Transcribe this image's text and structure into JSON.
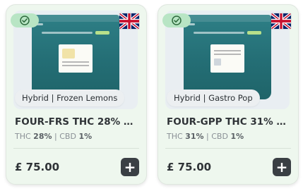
{
  "colors": {
    "card_bg": "#eef7ee",
    "verified_badge": "#b8e5c4",
    "add_button": "#3a3f44",
    "bag_teal": "#2e7f86"
  },
  "products": [
    {
      "verified_icon": "check-circle-icon",
      "flag_icon": "uk-flag-icon",
      "strain_chip": "Hybrid | Frozen Lemons",
      "title": "FOUR-FRS THC 28% CB...",
      "thc_label": "THC",
      "thc_value": "28%",
      "separator": "|",
      "cbd_label": "CBD",
      "cbd_value": "1%",
      "price": "£ 75.00",
      "add_icon": "plus-icon"
    },
    {
      "verified_icon": "check-circle-icon",
      "flag_icon": "uk-flag-icon",
      "strain_chip": "Hybrid | Gastro Pop",
      "title": "FOUR-GPP THC 31% CB...",
      "thc_label": "THC",
      "thc_value": "31%",
      "separator": "|",
      "cbd_label": "CBD",
      "cbd_value": "1%",
      "price": "£ 75.00",
      "add_icon": "plus-icon"
    }
  ]
}
